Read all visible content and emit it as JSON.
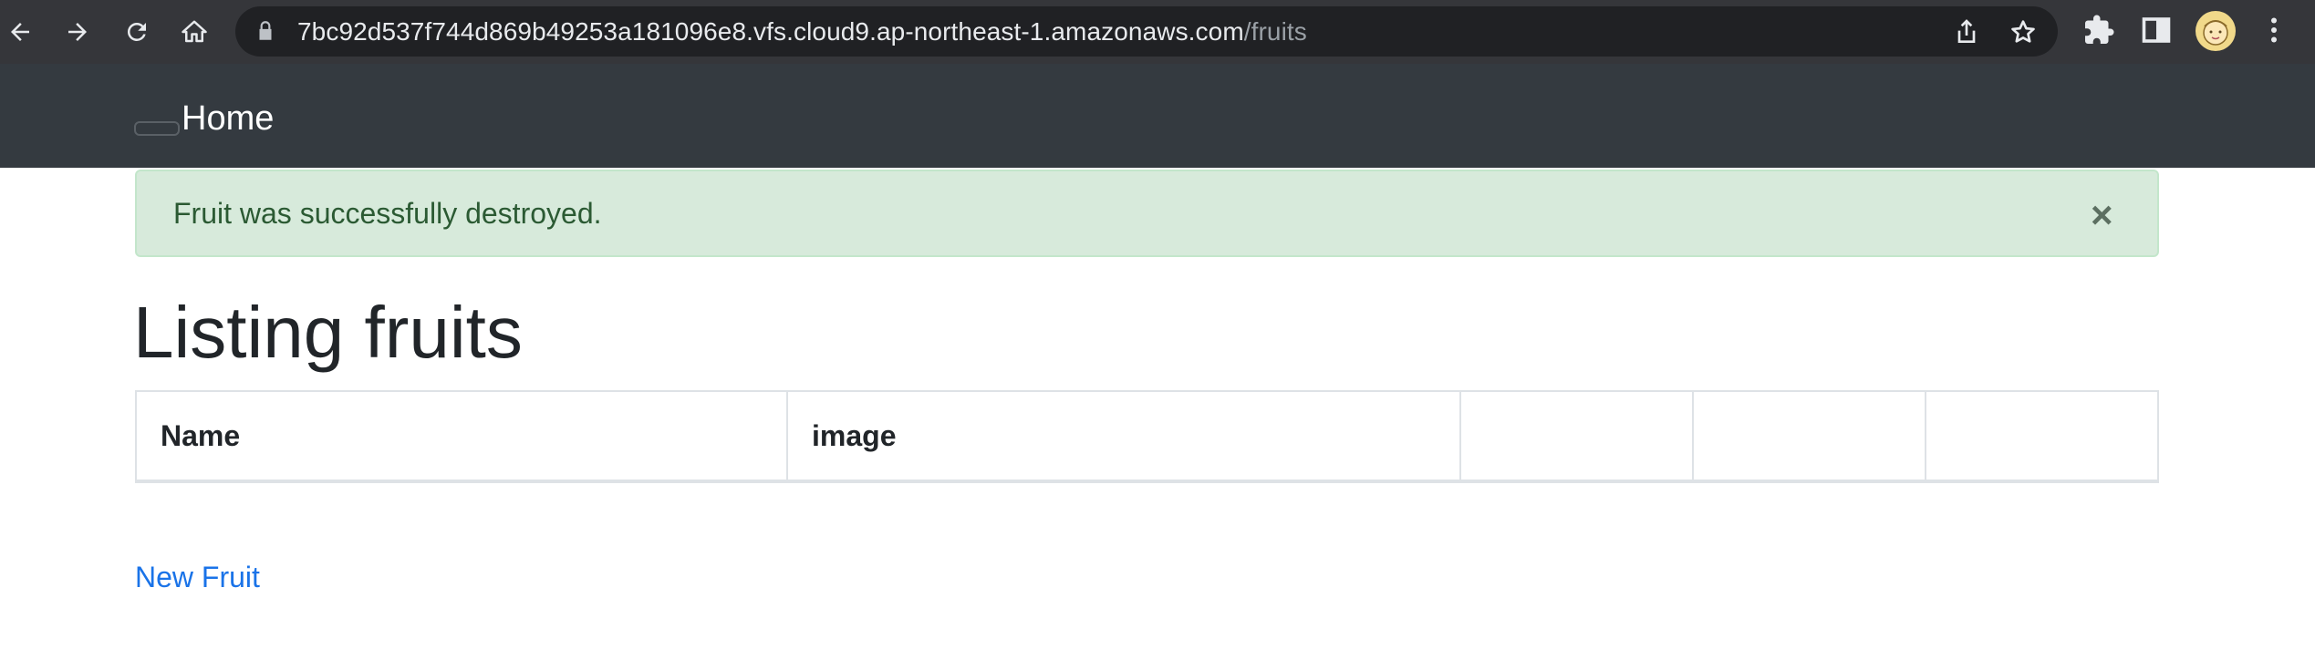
{
  "browser": {
    "url_host": "7bc92d537f744d869b49253a181096e8.vfs.cloud9.ap-northeast-1.amazonaws.com",
    "url_path": "/fruits",
    "icons": {
      "back": "back-arrow-icon",
      "forward": "forward-arrow-icon",
      "reload": "reload-icon",
      "home": "home-icon",
      "lock": "lock-icon",
      "share": "share-icon",
      "bookmark": "star-icon",
      "extensions": "puzzle-icon",
      "side_panel": "side-panel-icon",
      "profile": "avatar",
      "menu": "kebab-menu-icon"
    }
  },
  "navbar": {
    "brand": "Home"
  },
  "alert": {
    "message": "Fruit was successfully destroyed.",
    "close_symbol": "×",
    "color": "#d7eadb"
  },
  "page": {
    "title": "Listing fruits"
  },
  "table": {
    "columns": [
      "Name",
      "image",
      "",
      "",
      ""
    ],
    "rows": []
  },
  "links": {
    "new_fruit": "New Fruit",
    "color": "#1a73e8"
  }
}
